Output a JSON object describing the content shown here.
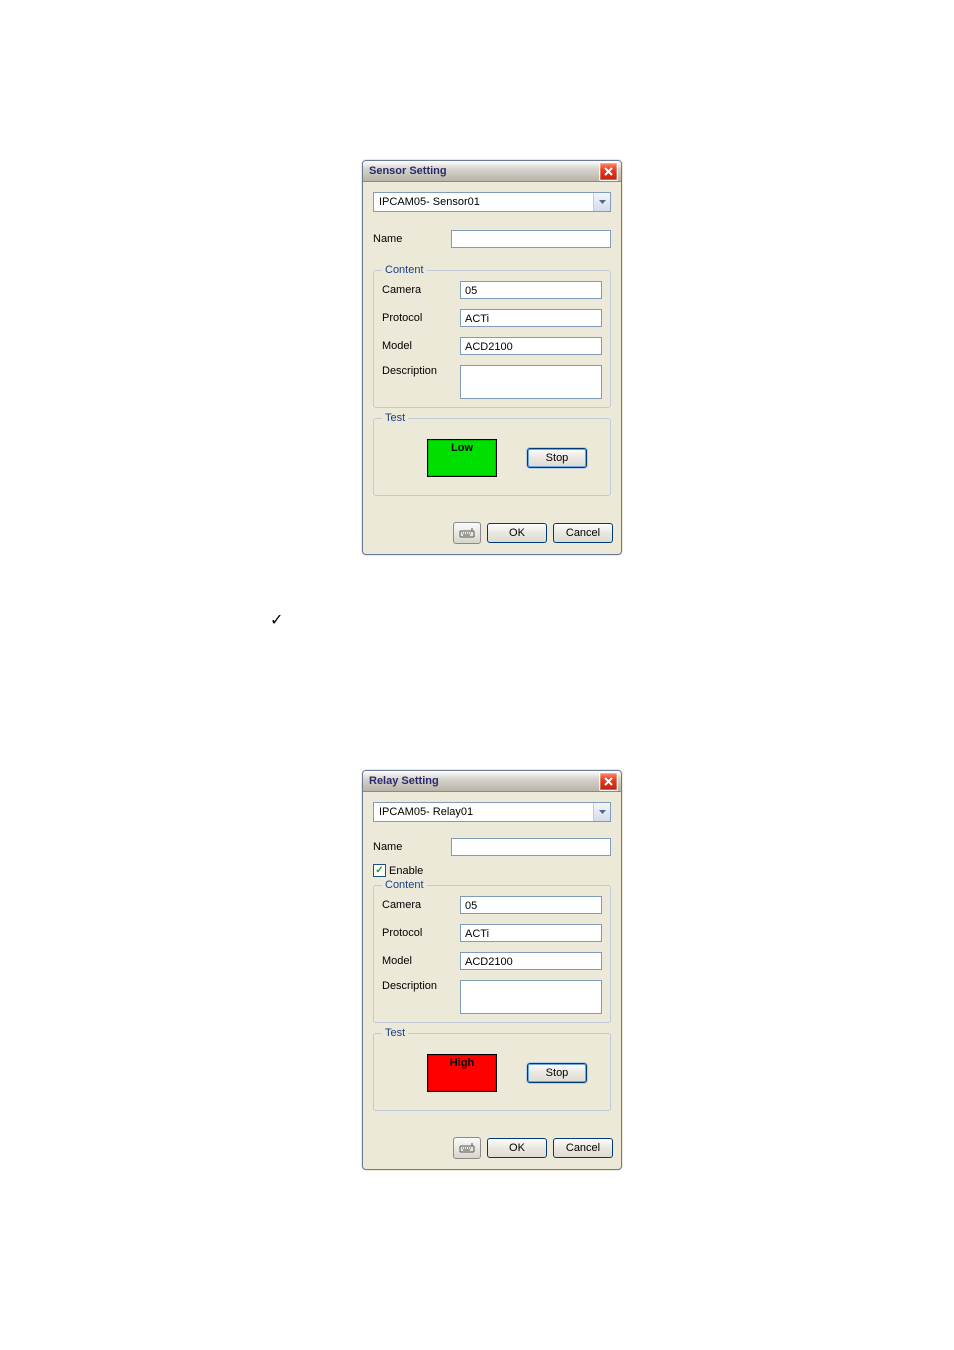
{
  "sensor": {
    "title": "Sensor Setting",
    "selector": "IPCAM05- Sensor01",
    "labels": {
      "name": "Name",
      "content": "Content",
      "camera": "Camera",
      "protocol": "Protocol",
      "model": "Model",
      "description": "Description",
      "test": "Test"
    },
    "values": {
      "name": "",
      "camera": "05",
      "protocol": "ACTi",
      "model": "ACD2100",
      "description": ""
    },
    "test_status": "Low",
    "buttons": {
      "stop": "Stop",
      "ok": "OK",
      "cancel": "Cancel"
    }
  },
  "relay": {
    "title": "Relay Setting",
    "selector": "IPCAM05- Relay01",
    "labels": {
      "name": "Name",
      "enable": "Enable",
      "content": "Content",
      "camera": "Camera",
      "protocol": "Protocol",
      "model": "Model",
      "description": "Description",
      "test": "Test"
    },
    "values": {
      "name": "",
      "enable_checked": true,
      "camera": "05",
      "protocol": "ACTi",
      "model": "ACD2100",
      "description": ""
    },
    "test_status": "High",
    "buttons": {
      "stop": "Stop",
      "ok": "OK",
      "cancel": "Cancel"
    }
  }
}
